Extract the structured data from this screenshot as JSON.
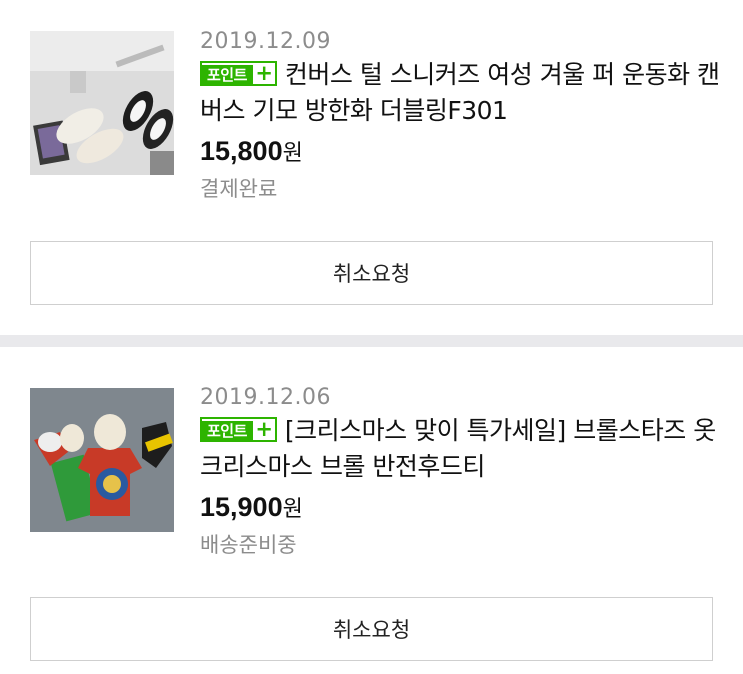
{
  "orders": [
    {
      "date": "2019.12.09",
      "badge": "포인트",
      "badge_plus": "+",
      "title": "컨버스 털 스니커즈 여성 겨울 퍼 운동화 캔버스 기모 방한화 더블링F301",
      "price": "15,800",
      "currency": "원",
      "status": "결제완료",
      "cancel_label": "취소요청",
      "image_icon": "sneakers-product-image"
    },
    {
      "date": "2019.12.06",
      "badge": "포인트",
      "badge_plus": "+",
      "title": "[크리스마스 맞이 특가세일] 브롤스타즈 옷 크리스마스 브롤 반전후드티",
      "price": "15,900",
      "currency": "원",
      "status": "배송준비중",
      "cancel_label": "취소요청",
      "image_icon": "hoodie-product-image"
    }
  ],
  "colors": {
    "badge_green": "#2db400",
    "muted_text": "#8c8c8c",
    "divider": "#e9e9ec"
  }
}
